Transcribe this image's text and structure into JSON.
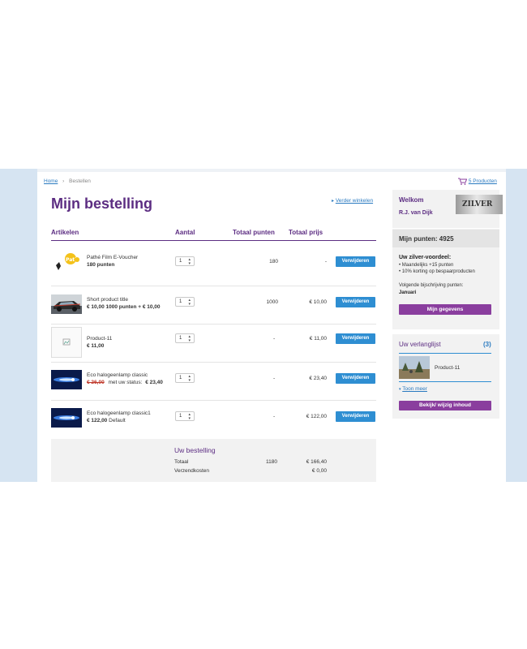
{
  "breadcrumb": {
    "home": "Home",
    "separator": "›",
    "current": "Bestellen"
  },
  "cart": {
    "label": "5 Producten",
    "icon": "cart-icon"
  },
  "page_title": "Mijn bestelling",
  "continue_link": "Verder winkelen",
  "columns": {
    "articles": "Artikelen",
    "quantity": "Aantal",
    "total_points": "Totaal punten",
    "total_price": "Totaal prijs"
  },
  "rows": [
    {
      "name": "Pathé Film E-Voucher",
      "detail": "180 punten",
      "qty": "1",
      "points": "180",
      "price": "-",
      "remove": "Verwijderen",
      "thumb": "pathe-logo"
    },
    {
      "name": "Short product title",
      "detail": "€ 10,00 1000 punten + € 10,00",
      "qty": "1",
      "points": "1000",
      "price": "€ 10,00",
      "remove": "Verwijderen",
      "thumb": "car-photo"
    },
    {
      "name": "Product-11",
      "detail": "€ 11,00",
      "qty": "1",
      "points": "-",
      "price": "€ 11,00",
      "remove": "Verwijderen",
      "thumb": "broken-image"
    },
    {
      "name": "Eco halogeenlamp classic",
      "detail_old": "€ 26,00",
      "detail_mid": "met uw status:",
      "detail_new": "€ 23,40",
      "qty": "1",
      "points": "-",
      "price": "€ 23,40",
      "remove": "Verwijderen",
      "thumb": "lamp-photo"
    },
    {
      "name": "Eco halogeenlamp classic1",
      "detail": "€ 122,00",
      "detail_suffix": "Default",
      "qty": "1",
      "points": "-",
      "price": "€ 122,00",
      "remove": "Verwijderen",
      "thumb": "lamp-photo"
    }
  ],
  "summary": {
    "title": "Uw bestelling",
    "total_label": "Totaal",
    "total_points": "1180",
    "total_price": "€ 166,40",
    "shipping_label": "Verzendkosten",
    "shipping_price": "€ 0,00"
  },
  "welcome": {
    "title": "Welkom",
    "name": "R.J. van Dijk",
    "badge": "ZILVER",
    "points_label": "Mijn punten: 4925",
    "benefit_title": "Uw zilver-voordeel:",
    "benefits": [
      "Maandelijks +15 punten",
      "10% korting op bespaarproducten"
    ],
    "next_label": "Volgende bijschrijving punten:",
    "next_value": "Januari",
    "button": "Mijn gegevens"
  },
  "wishlist": {
    "title": "Uw verlanglijst",
    "count": "(3)",
    "item": "Product-11",
    "more": "Toon meer",
    "button": "Bekijk/ wijzig inhoud"
  },
  "colors": {
    "purple": "#5c2d82",
    "blue_button": "#2e8ed2",
    "purple_button": "#8a3e9e",
    "band": "#d6e4f2"
  }
}
